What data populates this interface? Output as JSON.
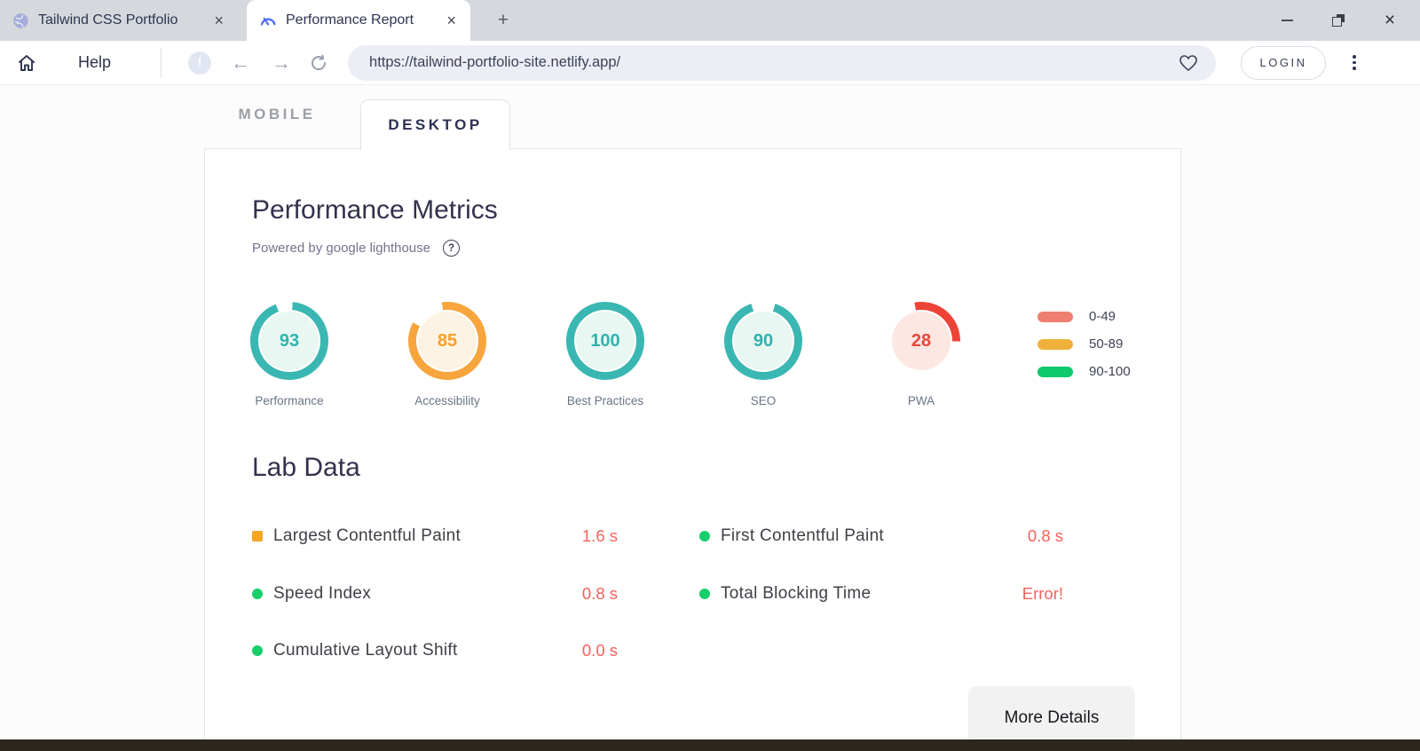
{
  "browser": {
    "tabs": [
      {
        "title": "Tailwind CSS Portfolio",
        "close_glyph": "×",
        "icon": "globe-icon"
      },
      {
        "title": "Performance Report",
        "close_glyph": "×",
        "icon": "gauge-icon"
      }
    ],
    "new_tab_label": "+",
    "window_controls": {
      "close_glyph": "×"
    }
  },
  "toolbar": {
    "help_label": "Help",
    "info_glyph": "!",
    "url": "https://tailwind-portfolio-site.netlify.app/",
    "login_label": "LOGIN"
  },
  "view_tabs": {
    "mobile_label": "MOBILE",
    "desktop_label": "DESKTOP"
  },
  "metrics": {
    "title": "Performance Metrics",
    "subtitle": "Powered by google lighthouse",
    "help_glyph": "?",
    "gauges": [
      {
        "label": "Performance",
        "value": "93",
        "ring_color": "#3ab7b2",
        "fill_color": "#e8f7f1",
        "text_color": "#2fb3ae",
        "arc_start_deg": 5
      },
      {
        "label": "Accessibility",
        "value": "85",
        "ring_color": "#f7a53c",
        "fill_color": "#fdf3e3",
        "text_color": "#f5a029",
        "arc_start_deg": -8
      },
      {
        "label": "Best Practices",
        "value": "100",
        "ring_color": "#3ab7b2",
        "fill_color": "#e8f7f1",
        "text_color": "#2fb3ae",
        "arc_start_deg": 0
      },
      {
        "label": "SEO",
        "value": "90",
        "ring_color": "#3ab7b2",
        "fill_color": "#e8f7f1",
        "text_color": "#2fb3ae",
        "arc_start_deg": 18
      },
      {
        "label": "PWA",
        "value": "28",
        "ring_color": "#ee4237",
        "fill_color": "#fce7e3",
        "text_color": "#e8473c",
        "arc_start_deg": -10
      }
    ],
    "legend": [
      {
        "label": "0-49",
        "color": "#ee7f6f"
      },
      {
        "label": "50-89",
        "color": "#f0b13c"
      },
      {
        "label": "90-100",
        "color": "#0fc96d"
      }
    ]
  },
  "lab_data": {
    "title": "Lab Data",
    "value_color": "#f2635c",
    "columns": [
      {
        "rows": [
          {
            "bullet": "square",
            "bullet_color": "#f5a623",
            "label": "Largest Contentful Paint",
            "value": "1.6 s"
          },
          {
            "bullet": "dot",
            "bullet_color": "#17ce6b",
            "label": "Speed Index",
            "value": "0.8 s"
          },
          {
            "bullet": "dot",
            "bullet_color": "#17ce6b",
            "label": "Cumulative Layout Shift",
            "value": "0.0 s"
          }
        ]
      },
      {
        "rows": [
          {
            "bullet": "dot",
            "bullet_color": "#17ce6b",
            "label": "First Contentful Paint",
            "value": "0.8 s"
          },
          {
            "bullet": "dot",
            "bullet_color": "#17ce6b",
            "label": "Total Blocking Time",
            "value": "Error!"
          }
        ]
      }
    ]
  },
  "footer": {
    "more_details_label": "More Details"
  }
}
